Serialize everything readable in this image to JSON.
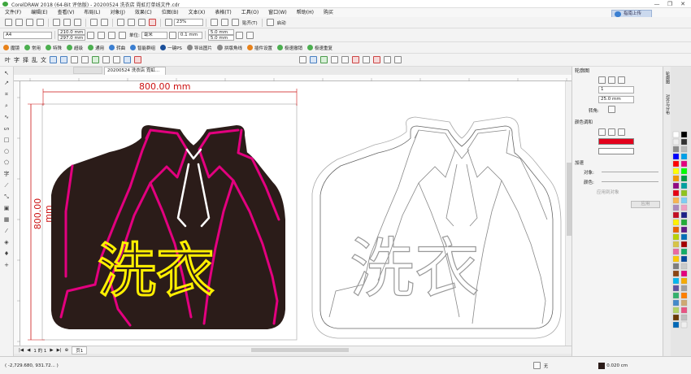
{
  "window": {
    "title": "CorelDRAW 2018 (64-Bit 评估版) - 20200524 洗衣店 霓虹灯单线文件.cdr",
    "minimize": "—",
    "restore": "❐",
    "close": "✕"
  },
  "menu": [
    "文件(F)",
    "编辑(E)",
    "查看(V)",
    "布局(L)",
    "对象(J)",
    "效果(C)",
    "位图(B)",
    "文本(X)",
    "表格(T)",
    "工具(O)",
    "窗口(W)",
    "帮助(H)",
    "购买"
  ],
  "cloud_button": "指南上传",
  "toolbar1": {
    "zoom": "23%",
    "snap_label": "贴齐(T)",
    "launch_label": "启动"
  },
  "toolbar2": {
    "page_size": "A4",
    "width": "210.0 mm",
    "height": "297.0 mm",
    "units_label": "单位:",
    "units_value": "毫米",
    "nudge": "0.1 mm",
    "dup_x": "5.0 mm",
    "dup_y": "5.0 mm"
  },
  "toolbar3": [
    "魔镜",
    "常用",
    "特殊",
    "超级",
    "通用",
    "转曲",
    "智能群组",
    "一键PS",
    "导出图片",
    "拼版角线",
    "插件设置",
    "极速撤销",
    "极速重复"
  ],
  "toolbar4": [
    "叶",
    "字",
    "择",
    "乱",
    "文"
  ],
  "document": {
    "tab_label": "20200524 洗衣店 霓虹...",
    "dim_h": "800.00 mm",
    "dim_v": "800.00 mm",
    "text_left": "洗衣",
    "text_right": "洗衣"
  },
  "colors": {
    "magenta": "#e3007f",
    "yellow": "#ffef00",
    "dark": "#2b1c19",
    "dim_red": "#cc1111"
  },
  "pagebar": {
    "page_count": "1 的 1",
    "page_tab": "页1"
  },
  "status": {
    "coords": "( -2,729.680, 931.72... )",
    "stroke": "0.020 cm",
    "fill_none": "无"
  },
  "panel": {
    "title": "轮廓图",
    "steps": "1",
    "offset": "25.0 mm",
    "corner_label": "转角:",
    "color_section": "颜色调和",
    "accel_section": "加速",
    "object_label": "对象:",
    "color_label": "颜色:",
    "apply_all": "应用到对象",
    "apply": "应用"
  },
  "sidetabs": [
    "轮廓图",
    "对齐与分布"
  ]
}
